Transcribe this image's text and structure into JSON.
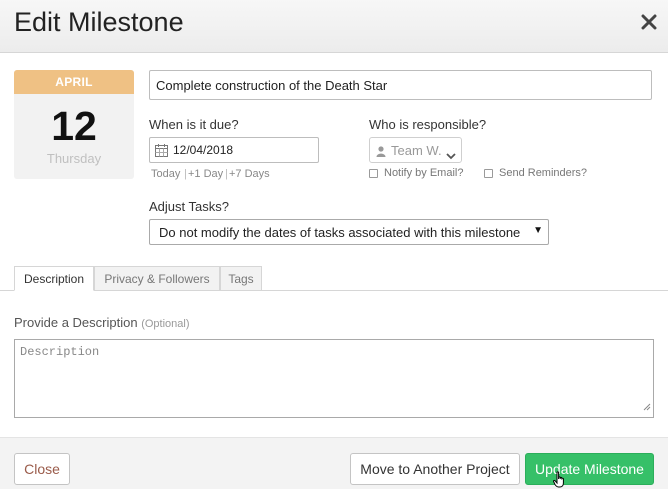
{
  "dialog": {
    "title": "Edit Milestone",
    "close_glyph": "✕"
  },
  "calendar": {
    "month": "APRIL",
    "day": "12",
    "weekday": "Thursday",
    "month_color": "#efc184"
  },
  "milestone": {
    "name": "Complete construction of the Death Star"
  },
  "due": {
    "label": "When is it due?",
    "value": "12/04/2018",
    "quick_links": [
      "Today",
      "+1 Day",
      "+7 Days"
    ]
  },
  "responsible": {
    "label": "Who is responsible?",
    "value": "Team W.",
    "notify_label": "Notify by Email?",
    "notify_checked": false,
    "reminders_label": "Send Reminders?",
    "reminders_checked": false
  },
  "adjust": {
    "label": "Adjust Tasks?",
    "selected": "Do not modify the dates of tasks associated with this milestone"
  },
  "tabs": [
    {
      "label": "Description",
      "active": true
    },
    {
      "label": "Privacy & Followers",
      "active": false
    },
    {
      "label": "Tags",
      "active": false
    }
  ],
  "description": {
    "label": "Provide a Description",
    "optional_label": "(Optional)",
    "placeholder": "Description"
  },
  "footer": {
    "close_label": "Close",
    "move_label": "Move to Another Project",
    "update_label": "Update Milestone",
    "primary_color": "#36c068"
  }
}
